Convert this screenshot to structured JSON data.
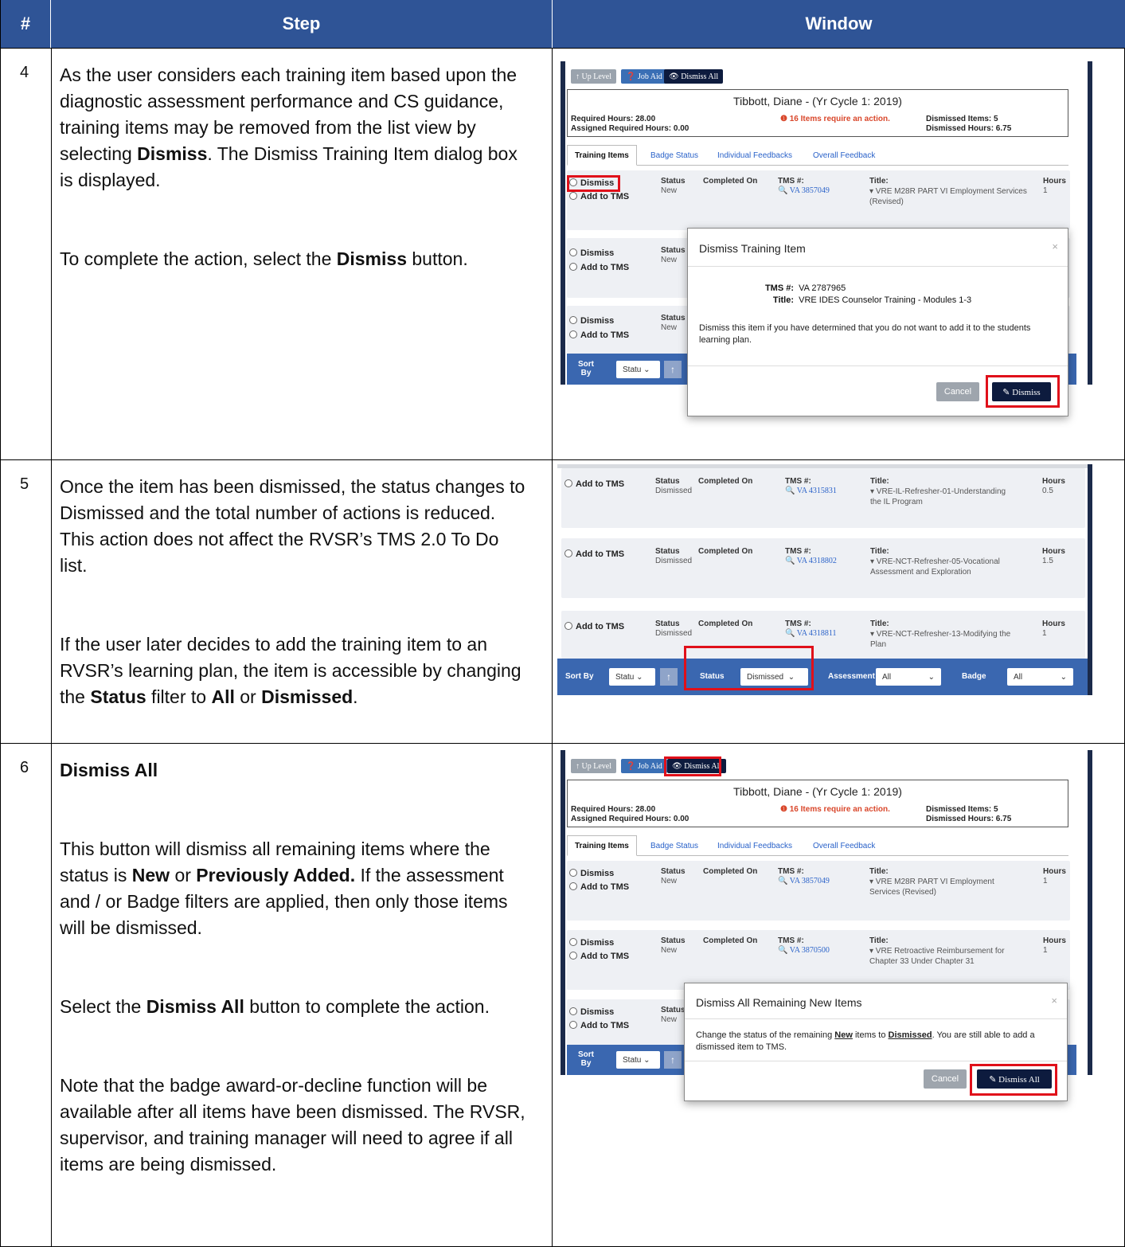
{
  "header": {
    "num": "#",
    "step": "Step",
    "window": "Window"
  },
  "rows": [
    {
      "num": "4",
      "p1a": "As the user considers each training item based upon the diagnostic assessment performance and CS guidance, training items may be removed from the list view by selecting ",
      "p1b": "Dismiss",
      "p1c": ".  The Dismiss Training Item dialog box is displayed.",
      "p2a": "To complete the action, select the ",
      "p2b": "Dismiss",
      "p2c": " button."
    },
    {
      "num": "5",
      "p1": "Once the item has been dismissed, the status changes to Dismissed and the total number of actions is reduced.  This action does not affect the RVSR’s TMS 2.0 To Do list.",
      "p2a": "If the user later decides to add the training item to an RVSR’s learning plan, the item is accessible by changing the ",
      "p2b": "Status",
      "p2c": " filter to ",
      "p2d": "All",
      "p2e": " or ",
      "p2f": "Dismissed",
      "p2g": "."
    },
    {
      "num": "6",
      "title": "Dismiss All",
      "p1a": "This button will dismiss all remaining items where the status is ",
      "p1b": "New",
      "p1c": " or ",
      "p1d": "Previously Added.",
      "p1e": " If the assessment and / or Badge filters are applied, then only those items will be dismissed.",
      "p2a": "Select the ",
      "p2b": "Dismiss All",
      "p2c": " button to complete the action.",
      "p3": "Note that the badge award-or-decline function will be available after all items have been dismissed. The RVSR, supervisor, and training manager will need to agree if all items are being dismissed."
    }
  ],
  "ui": {
    "toolbar": {
      "up_level": "↑ Up Level",
      "job_aid": "❓ Job Aid",
      "dismiss_all": "👁 Dismiss All"
    },
    "person": "Tibbott, Diane - (Yr Cycle 1: 2019)",
    "required_hours": "Required Hours: 28.00",
    "assigned_hours": "Assigned Required Hours: 0.00",
    "alert": "❶ 16 Items require an action.",
    "dismissed_items": "Dismissed Items: 5",
    "dismissed_hours": "Dismissed Hours: 6.75",
    "tabs": [
      "Training Items",
      "Badge Status",
      "Individual Feedbacks",
      "Overall Feedback"
    ],
    "labels": {
      "dismiss": "Dismiss",
      "add_to_tms": "Add to TMS",
      "status": "Status",
      "completed_on": "Completed On",
      "tms_no": "TMS #:",
      "title": "Title:",
      "hours": "Hours",
      "new": "New",
      "dismissed": "Dismissed",
      "sort": "Sort",
      "by": "By",
      "sort_by": "Sort By",
      "statu": "Statu",
      "stat": "Statu",
      "status_filter": "Status",
      "assessment": "Assessment",
      "badge": "Badge",
      "all": "All",
      "dismissed_sel": "Dismissed"
    },
    "shot4_items": [
      {
        "tms": "🔍 VA 3857049",
        "title": "▾ VRE M28R PART VI Employment Services (Revised)",
        "hours": "1"
      }
    ],
    "modal4": {
      "title": "Dismiss Training Item",
      "close": "×",
      "tms_label": "TMS #:",
      "tms_value": "VA 2787965",
      "title_label": "Title:",
      "title_value": "VRE IDES Counselor Training - Modules 1-3",
      "body": "Dismiss this item if you have determined that you do not want to add it to the students learning plan.",
      "cancel": "Cancel",
      "dismiss": "✎ Dismiss"
    },
    "shot5_items": [
      {
        "tms": "🔍 VA 4315831",
        "title1": "▾ VRE-IL-Refresher-01-Understanding",
        "title2": "the IL Program",
        "hours": "0.5"
      },
      {
        "tms": "🔍 VA 4318802",
        "title1": "▾ VRE-NCT-Refresher-05-Vocational",
        "title2": "Assessment and Exploration",
        "hours": "1.5"
      },
      {
        "tms": "🔍 VA 4318811",
        "title1": "▾ VRE-NCT-Refresher-13-Modifying the",
        "title2": "Plan",
        "hours": "1"
      }
    ],
    "shot6_items": [
      {
        "tms": "🔍 VA 3857049",
        "title1": "▾ VRE M28R PART VI Employment",
        "title2": "Services (Revised)",
        "hours": "1"
      },
      {
        "tms": "🔍 VA 3870500",
        "title1": "▾ VRE Retroactive Reimbursement for",
        "title2": "Chapter 33 Under Chapter 31",
        "hours": "1"
      }
    ],
    "modal6": {
      "title": "Dismiss All Remaining New Items",
      "close": "×",
      "body_a": "Change the status of the remaining ",
      "body_b": "New",
      "body_c": " items to ",
      "body_d": "Dismissed",
      "body_e": ". You are still able to add a dismissed item to TMS.",
      "cancel": "Cancel",
      "dismiss_all": "✎ Dismiss All"
    },
    "sort_arrow": "↑",
    "chevron": "⌄"
  }
}
